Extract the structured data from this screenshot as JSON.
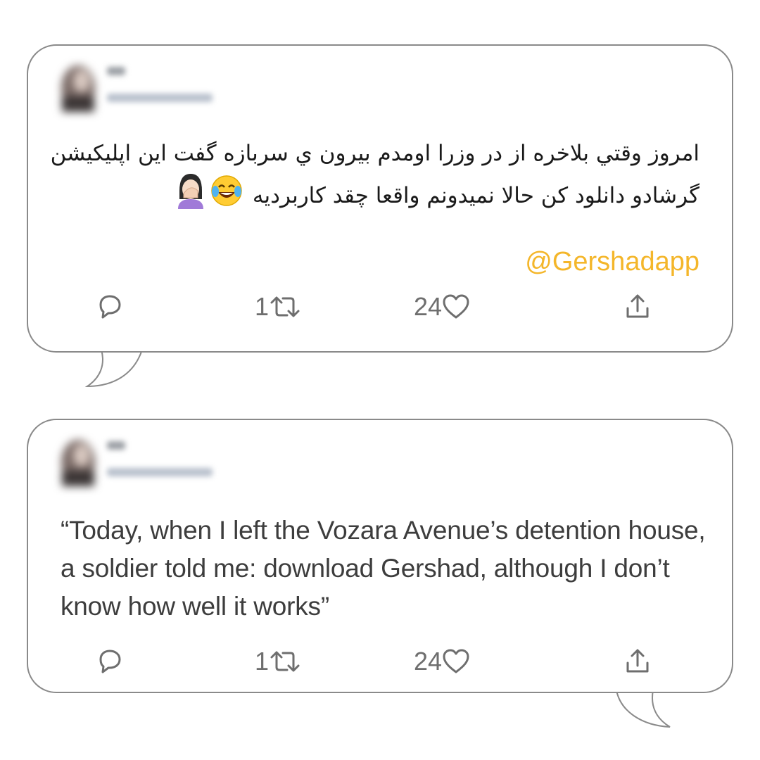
{
  "tweets": [
    {
      "persian_text": "امروز وقتي بلاخره از در وزرا اومدم بيرون ي سربازه گفت اين اپليکيشن گرشادو دانلود کن حالا نميدونم واقعا چقد کاربرديه",
      "mention": "@Gershadapp",
      "emojis": [
        "face-with-tears-of-joy-icon",
        "woman-facepalming-icon"
      ],
      "retweet_count": "1",
      "like_count": "24"
    },
    {
      "english_text": "“Today, when I left the Vozara Avenue’s detention house, a soldier told me: download Gershad, although I don’t know how well it works”",
      "retweet_count": "1",
      "like_count": "24"
    }
  ],
  "colors": {
    "mention": "#f4b62a",
    "border": "#8a8a8a",
    "icon": "#6e6e6e"
  }
}
